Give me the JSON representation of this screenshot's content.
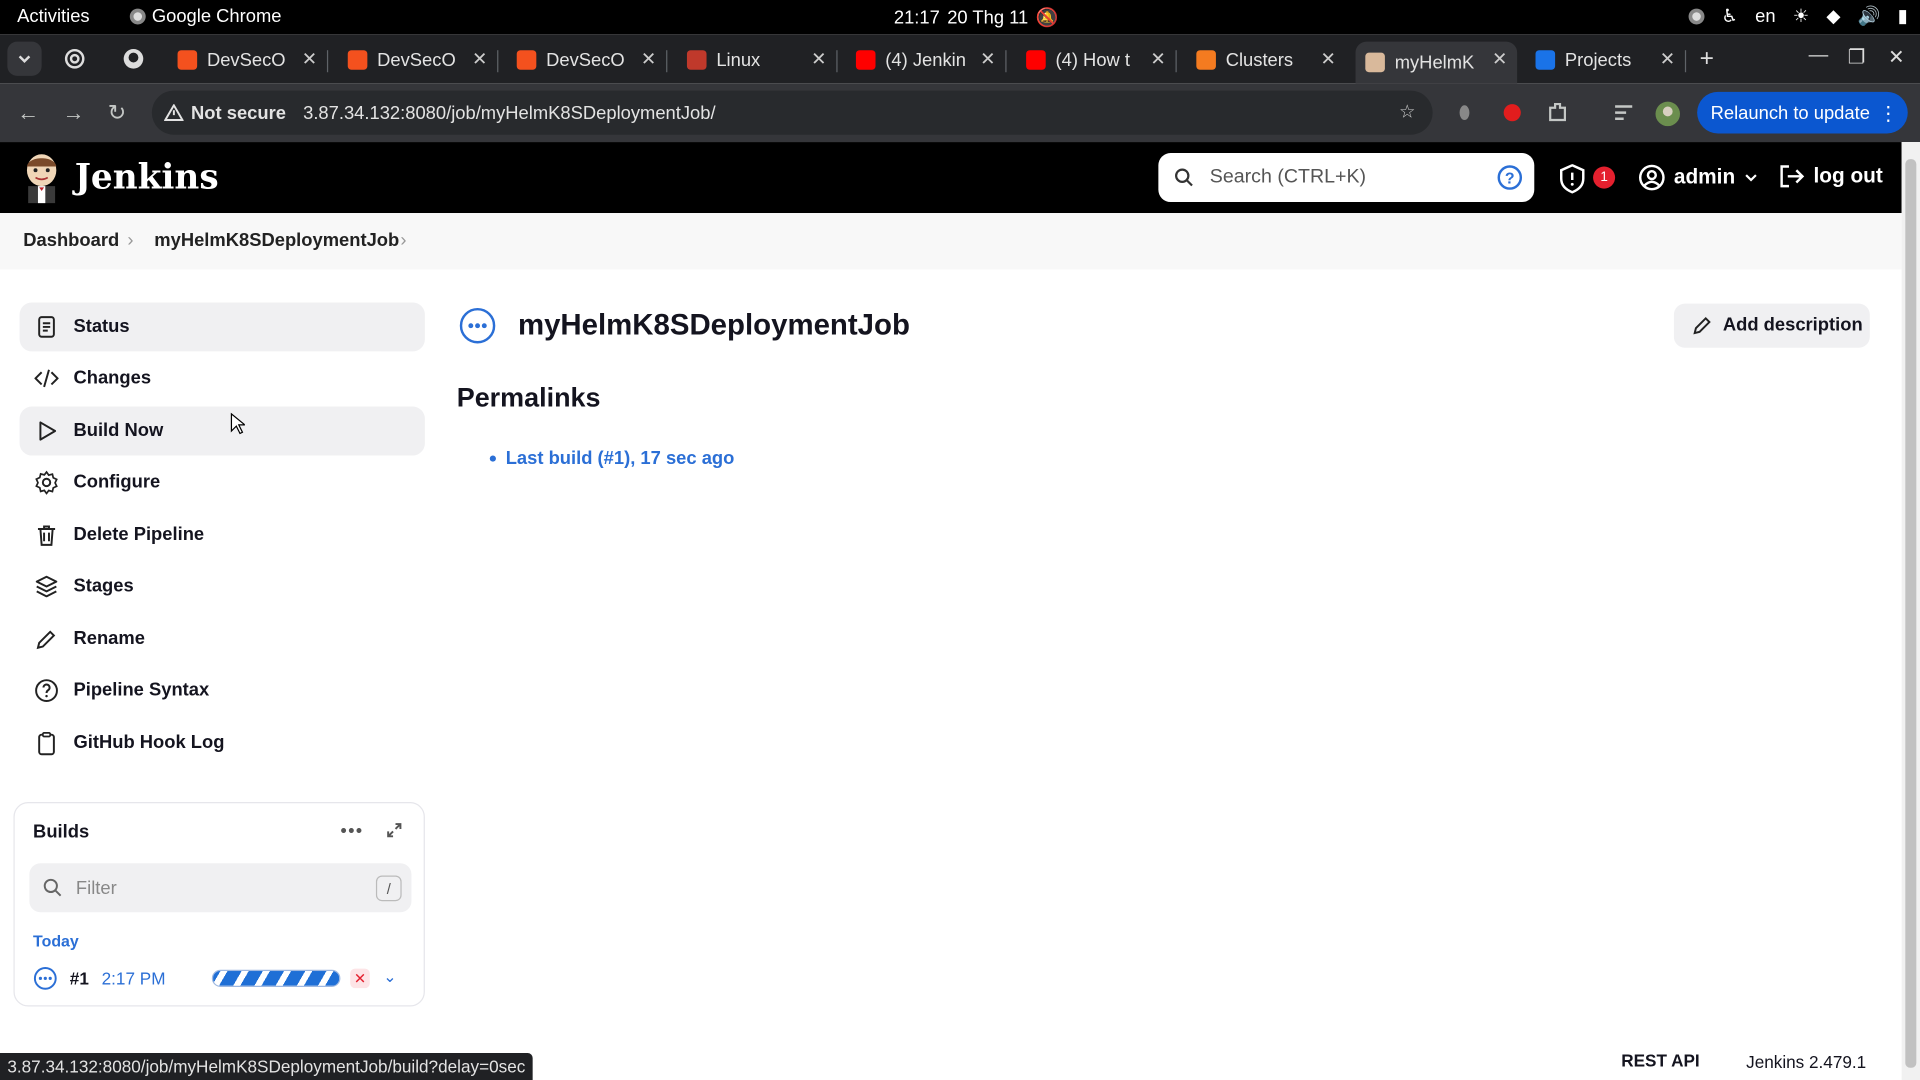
{
  "os_bar": {
    "activities": "Activities",
    "app_name": "Google Chrome",
    "time": "21:17",
    "date": "20 Thg 11",
    "lang": "en"
  },
  "tabs": [
    {
      "title": "DevSecO",
      "favicon_color": "#f4511e"
    },
    {
      "title": "DevSecO",
      "favicon_color": "#f4511e"
    },
    {
      "title": "DevSecO",
      "favicon_color": "#f4511e"
    },
    {
      "title": "Linux",
      "favicon_color": "#c0392b"
    },
    {
      "title": "(4) Jenkin",
      "favicon_color": "#ff0000"
    },
    {
      "title": "(4) How t",
      "favicon_color": "#ff0000"
    },
    {
      "title": "Clusters",
      "favicon_color": "#f47b20"
    },
    {
      "title": "myHelmK",
      "favicon_color": "#d9b99b",
      "active": true
    },
    {
      "title": "Projects",
      "favicon_color": "#1a73e8"
    }
  ],
  "address": {
    "security": "Not secure",
    "url": "3.87.34.132:8080/job/myHelmK8SDeploymentJob/",
    "relaunch": "Relaunch to update"
  },
  "header": {
    "title": "Jenkins",
    "search_placeholder": "Search (CTRL+K)",
    "alert_count": "1",
    "user": "admin",
    "logout": "log out"
  },
  "breadcrumb": [
    "Dashboard",
    "myHelmK8SDeploymentJob"
  ],
  "sidebar": {
    "items": [
      {
        "label": "Status",
        "icon": "document-icon"
      },
      {
        "label": "Changes",
        "icon": "code-icon"
      },
      {
        "label": "Build Now",
        "icon": "play-icon"
      },
      {
        "label": "Configure",
        "icon": "gear-icon"
      },
      {
        "label": "Delete Pipeline",
        "icon": "trash-icon"
      },
      {
        "label": "Stages",
        "icon": "layers-icon"
      },
      {
        "label": "Rename",
        "icon": "pencil-icon"
      },
      {
        "label": "Pipeline Syntax",
        "icon": "help-icon"
      },
      {
        "label": "GitHub Hook Log",
        "icon": "clipboard-icon"
      }
    ]
  },
  "builds": {
    "title": "Builds",
    "filter_placeholder": "Filter",
    "filter_shortcut": "/",
    "group": "Today",
    "rows": [
      {
        "number": "#1",
        "time": "2:17 PM"
      }
    ]
  },
  "main": {
    "job_title": "myHelmK8SDeploymentJob",
    "add_description": "Add description",
    "permalinks_title": "Permalinks",
    "permalinks": [
      "Last build (#1), 17 sec ago"
    ]
  },
  "footer": {
    "status_url": "3.87.34.132:8080/job/myHelmK8SDeploymentJob/build?delay=0sec",
    "rest_api": "REST API",
    "version": "Jenkins 2.479.1"
  },
  "colors": {
    "accent": "#2b6fd6",
    "header": "#000000",
    "chrome_dark": "#202124",
    "relaunch": "#0b57d0",
    "danger": "#e4202e"
  }
}
